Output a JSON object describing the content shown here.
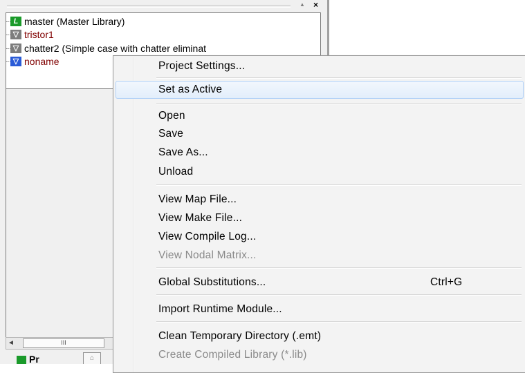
{
  "panel": {
    "tree_items": [
      {
        "label": "master (Master Library)",
        "icon": "library-icon",
        "icon_glyph": "L",
        "color": "#000000"
      },
      {
        "label": "tristor1",
        "icon": "case-icon",
        "icon_glyph": "▽",
        "color": "#800000"
      },
      {
        "label": "chatter2 (Simple case with chatter eliminat",
        "icon": "case-icon",
        "icon_glyph": "▽",
        "color": "#000000"
      },
      {
        "label": "noname",
        "icon": "active-case-icon",
        "icon_glyph": "▽",
        "color": "#800000"
      }
    ],
    "scroll_arrow": "◄",
    "scroll_thumb": "III",
    "bottom_tab_label": "Pr",
    "close_glyph": "×",
    "pin_glyph": "▲"
  },
  "menu": {
    "items": [
      {
        "label": "Project Settings...",
        "shortcut": "",
        "disabled": false
      },
      {
        "label": "Set as Active",
        "shortcut": "",
        "disabled": false,
        "highlighted": true
      },
      {
        "label": "Open",
        "shortcut": "",
        "disabled": false
      },
      {
        "label": "Save",
        "shortcut": "",
        "disabled": false
      },
      {
        "label": "Save As...",
        "shortcut": "",
        "disabled": false
      },
      {
        "label": "Unload",
        "shortcut": "",
        "disabled": false
      },
      {
        "label": "View Map File...",
        "shortcut": "",
        "disabled": false
      },
      {
        "label": "View Make File...",
        "shortcut": "",
        "disabled": false
      },
      {
        "label": "View Compile Log...",
        "shortcut": "",
        "disabled": false
      },
      {
        "label": "View Nodal Matrix...",
        "shortcut": "",
        "disabled": true
      },
      {
        "label": "Global Substitutions...",
        "shortcut": "Ctrl+G",
        "disabled": false
      },
      {
        "label": "Import Runtime Module...",
        "shortcut": "",
        "disabled": false
      },
      {
        "label": "Clean Temporary Directory (.emt)",
        "shortcut": "",
        "disabled": false
      },
      {
        "label": "Create Compiled Library (*.lib)",
        "shortcut": "",
        "disabled": true
      }
    ]
  },
  "colors": {
    "menu_highlight_border": "#aecff7",
    "disabled_text": "#8a8a8a",
    "library_icon": "#1a9a2a",
    "active_case_icon": "#2a5bd7"
  }
}
